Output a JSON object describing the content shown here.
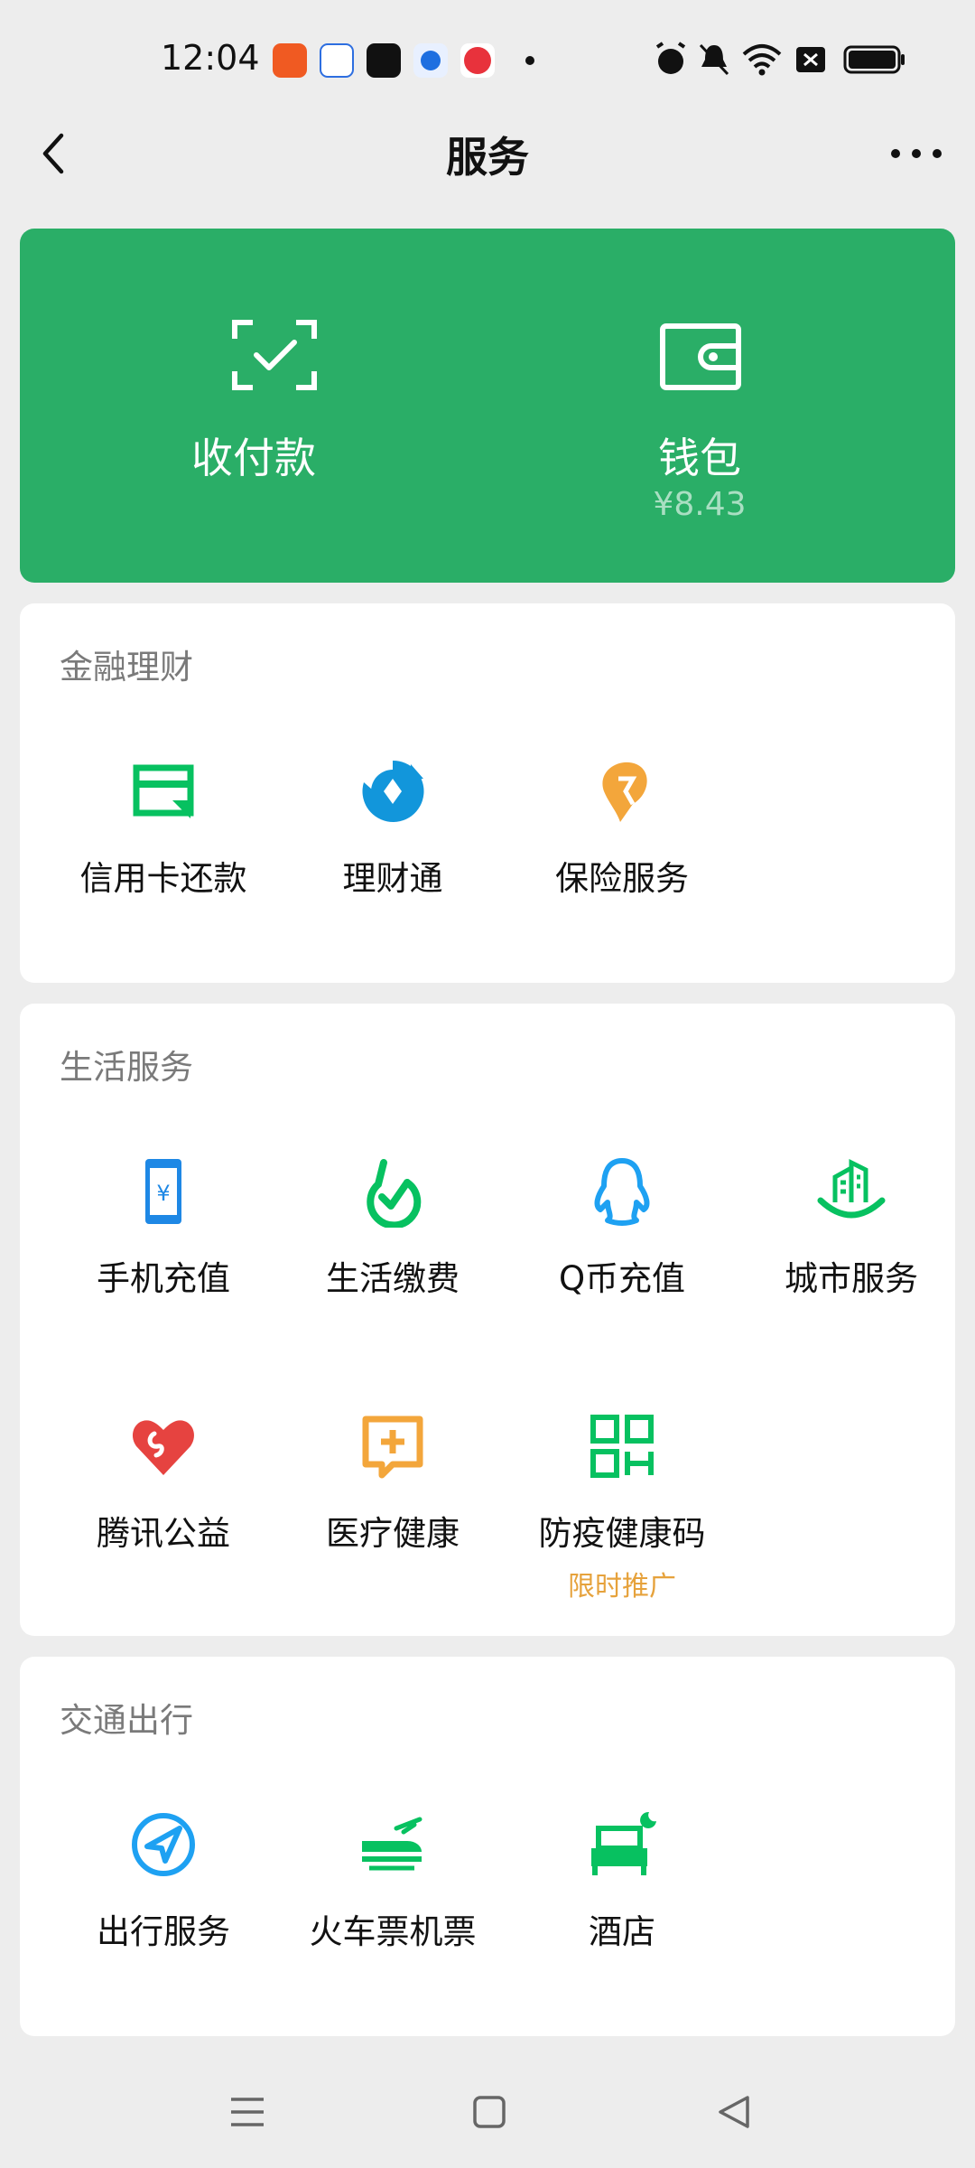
{
  "status": {
    "time": "12:04"
  },
  "header": {
    "title": "服务"
  },
  "pay_card": {
    "payment_label": "收付款",
    "wallet_label": "钱包",
    "wallet_balance": "¥8.43"
  },
  "finance": {
    "title": "金融理财",
    "items": [
      {
        "label": "信用卡还款",
        "icon": "credit-card-icon"
      },
      {
        "label": "理财通",
        "icon": "wealth-icon"
      },
      {
        "label": "保险服务",
        "icon": "insurance-icon"
      }
    ]
  },
  "life": {
    "title": "生活服务",
    "items": [
      {
        "label": "手机充值",
        "icon": "phone-topup-icon"
      },
      {
        "label": "生活缴费",
        "icon": "utility-icon"
      },
      {
        "label": "Q币充值",
        "icon": "qq-coin-icon"
      },
      {
        "label": "城市服务",
        "icon": "city-icon"
      },
      {
        "label": "腾讯公益",
        "icon": "charity-icon"
      },
      {
        "label": "医疗健康",
        "icon": "medical-icon"
      },
      {
        "label": "防疫健康码",
        "icon": "qr-code-icon",
        "badge": "限时推广"
      }
    ]
  },
  "transport": {
    "title": "交通出行",
    "items": [
      {
        "label": "出行服务",
        "icon": "navigation-icon"
      },
      {
        "label": "火车票机票",
        "icon": "train-plane-icon"
      },
      {
        "label": "酒店",
        "icon": "hotel-icon"
      }
    ]
  },
  "colors": {
    "green": "#2aae67",
    "brand_green": "#07c160",
    "badge_orange": "#e6a23c"
  }
}
